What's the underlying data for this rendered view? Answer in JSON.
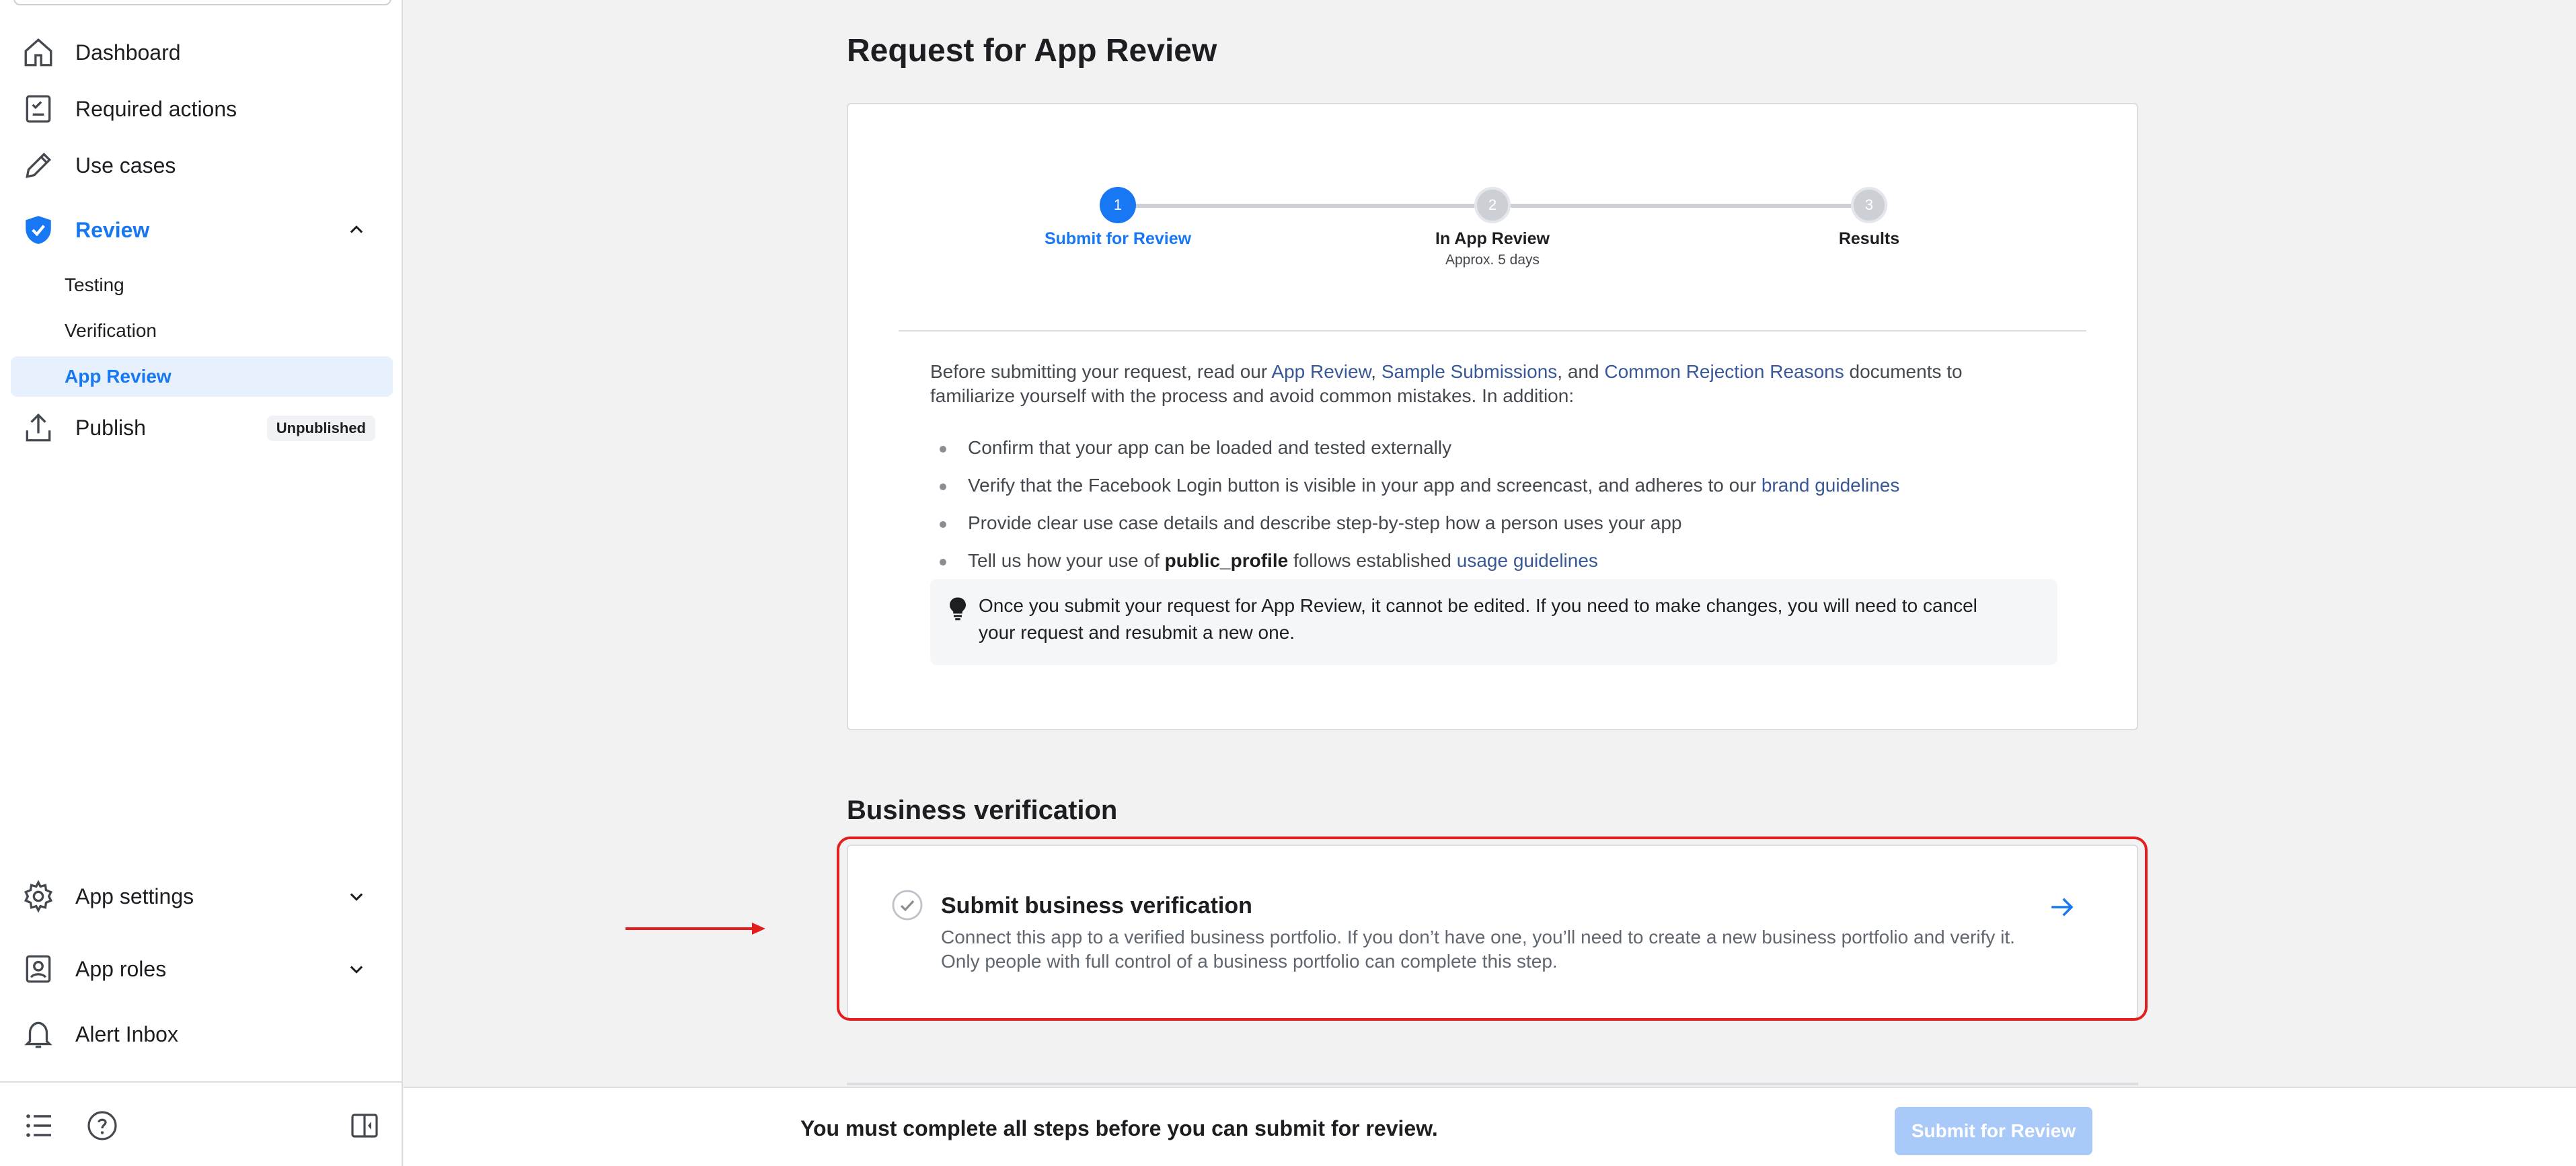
{
  "sidebar": {
    "items": [
      {
        "label": "Dashboard",
        "icon": "home-icon"
      },
      {
        "label": "Required actions",
        "icon": "checklist-icon"
      },
      {
        "label": "Use cases",
        "icon": "pencil-icon"
      },
      {
        "label": "Review",
        "icon": "shield-check-icon"
      },
      {
        "label": "Publish",
        "icon": "upload-icon",
        "badge": "Unpublished"
      }
    ],
    "review_subitems": [
      {
        "label": "Testing"
      },
      {
        "label": "Verification"
      },
      {
        "label": "App Review"
      }
    ],
    "bottom_items": [
      {
        "label": "App settings",
        "icon": "gear-icon"
      },
      {
        "label": "App roles",
        "icon": "person-badge-icon"
      },
      {
        "label": "Alert Inbox",
        "icon": "bell-icon"
      }
    ]
  },
  "main": {
    "title": "Request for App Review",
    "stepper": {
      "steps": [
        {
          "number": "1",
          "label": "Submit for Review",
          "sub": ""
        },
        {
          "number": "2",
          "label": "In App Review",
          "sub": "Approx. 5 days"
        },
        {
          "number": "3",
          "label": "Results",
          "sub": ""
        }
      ]
    },
    "intro": {
      "part1": "Before submitting your request, read our ",
      "link1": "App Review",
      "part2": ", ",
      "link2": "Sample Submissions",
      "part3": ", and ",
      "link3": "Common Rejection Reasons",
      "part4": " documents to familiarize yourself with the process and avoid common mistakes. In addition:"
    },
    "bullets": {
      "b1": "Confirm that your app can be loaded and tested externally",
      "b2_text": "Verify that the Facebook Login button is visible in your app and screencast, and adheres to our ",
      "b2_link": "brand guidelines",
      "b3": "Provide clear use case details and describe step-by-step how a person uses your app",
      "b4_pre": "Tell us how your use of ",
      "b4_bold": "public_profile",
      "b4_mid": " follows established ",
      "b4_link": "usage guidelines"
    },
    "notice": "Once you submit your request for App Review, it cannot be edited. If you need to make changes, you will need to cancel your request and resubmit a new one.",
    "business_section": {
      "title": "Business verification",
      "task_title": "Submit business verification",
      "task_desc": "Connect this app to a verified business portfolio. If you don’t have one, you’ll need to create a new business portfolio and verify it. Only people with full control of a business portfolio can complete this step."
    }
  },
  "footer": {
    "message": "You must complete all steps before you can submit for review.",
    "submit_label": "Submit for Review"
  },
  "colors": {
    "accent": "#1877f2",
    "highlight": "#e41e1e",
    "disabled_button": "#a9c9f8"
  }
}
